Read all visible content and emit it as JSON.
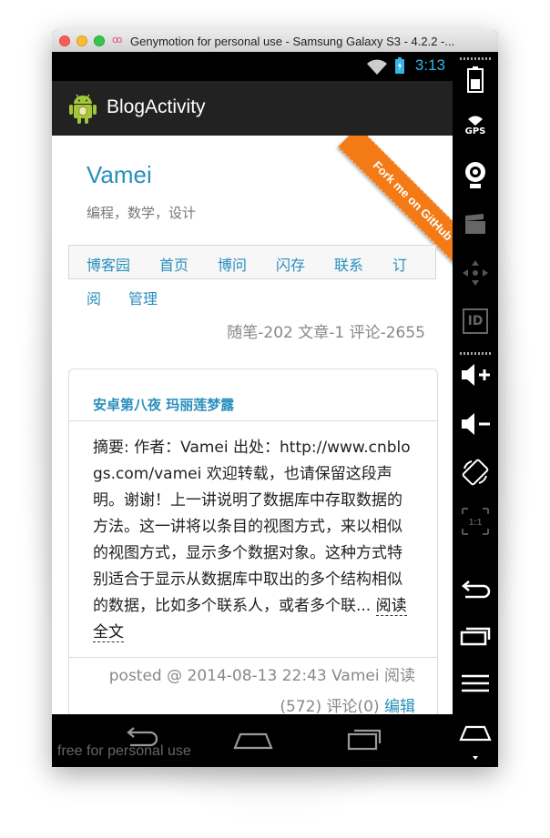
{
  "window": {
    "title": "Genymotion for personal use - Samsung Galaxy S3 - 4.2.2 -..."
  },
  "statusbar": {
    "time": "3:13"
  },
  "app": {
    "title": "BlogActivity"
  },
  "blog": {
    "title": "Vamei",
    "subtitle": "编程，数学，设计",
    "ribbon": "Fork me on GitHub",
    "nav": [
      "博客园",
      "首页",
      "博问",
      "闪存",
      "联系",
      "订",
      "阅",
      "管理"
    ],
    "stats": "随笔-202  文章-1  评论-2655"
  },
  "post": {
    "title": "安卓第八夜 玛丽莲梦露",
    "summary": "摘要: 作者：Vamei 出处：http://www.cnblogs.com/vamei 欢迎转载，也请保留这段声明。谢谢！上一讲说明了数据库中存取数据的方法。这一讲将以条目的视图方式，来以相似的视图方式，显示多个数据对象。这种方式特别适合于显示从数据库中取出的多个结构相似的数据，比如多个联系人，或者多个联... ",
    "read_more": "阅读全文",
    "footer_line1": "posted @ 2014-08-13 22:43 Vamei 阅读",
    "footer_line2": "(572) 评论(0) ",
    "edit": "编辑"
  },
  "navbar": {
    "watermark": "free for personal use"
  },
  "icons": {
    "wifi": "wifi-icon",
    "battery": "battery-icon",
    "android": "android-icon",
    "back": "back-icon",
    "home": "home-icon",
    "recent": "recent-apps-icon",
    "gps": "gps-icon",
    "camera": "webcam-icon",
    "video": "video-capture-icon",
    "dpad": "dpad-icon",
    "id": "id-icon",
    "vol_up": "volume-up-icon",
    "vol_down": "volume-down-icon",
    "rotate": "rotate-icon",
    "scale": "scale-icon",
    "menu": "menu-icon",
    "power": "power-icon"
  },
  "side_labels": {
    "gps": "GPS",
    "id": "ID",
    "scale": "1:1"
  },
  "colors": {
    "accent": "#2a8fbd",
    "ribbon": "#f37a14",
    "status": "#33b5e5"
  }
}
